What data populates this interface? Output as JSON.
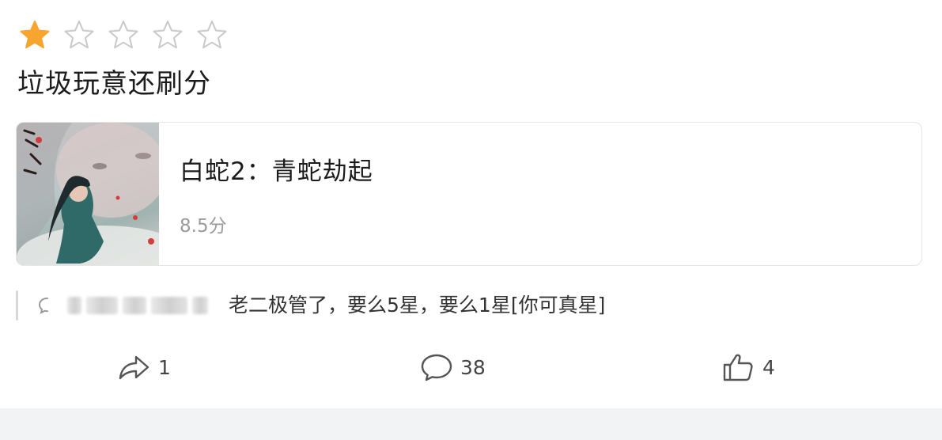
{
  "rating": {
    "value": 1,
    "max": 5,
    "filled_color": "#f7a52f",
    "empty_color": "#c9c9c9"
  },
  "review": {
    "text": "垃圾玩意还刷分"
  },
  "movie": {
    "title": "白蛇2：青蛇劫起",
    "score": "8.5分",
    "poster_icon": "movie-poster-image"
  },
  "comment_preview": {
    "icon": "comment-bubble-icon",
    "author_blurred": true,
    "text": "老二极管了，要么5星，要么1星[你可真星]"
  },
  "actions": {
    "share": {
      "icon": "share-arrow-icon",
      "count": "1"
    },
    "comment": {
      "icon": "comment-icon",
      "count": "38"
    },
    "like": {
      "icon": "thumbs-up-icon",
      "count": "4"
    }
  },
  "colors": {
    "accent_star": "#f7a52f",
    "muted_text": "#9a9a9a",
    "border": "#e6e6e6",
    "footer_bg": "#f2f3f5"
  }
}
